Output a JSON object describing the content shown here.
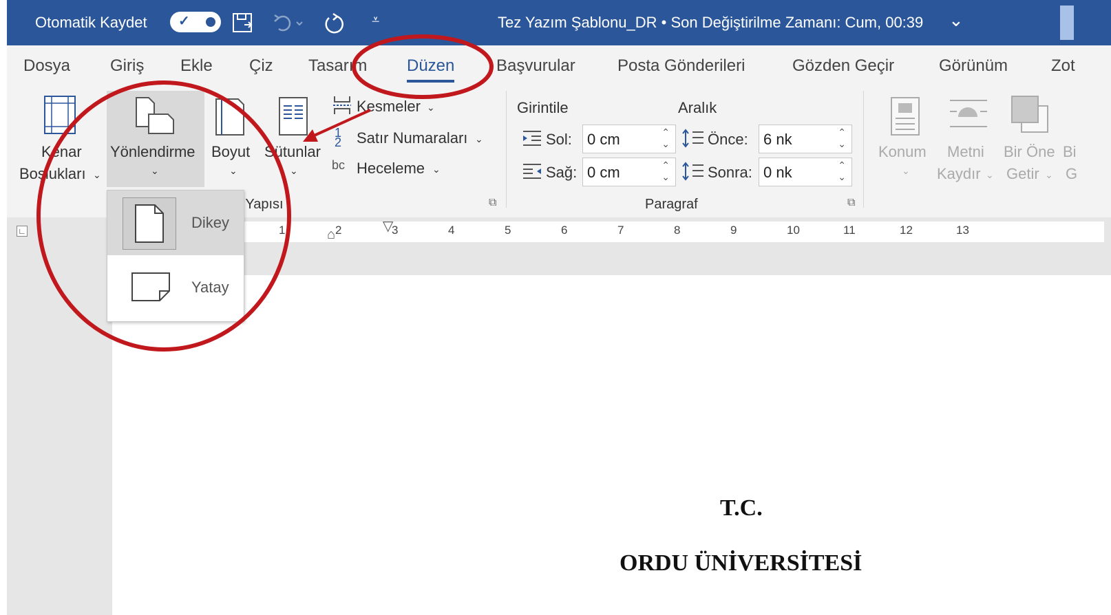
{
  "titlebar": {
    "autosave_label": "Otomatik Kaydet",
    "doc_title": "Tez Yazım Şablonu_DR  •  Son Değiştirilme Zamanı: Cum, 00:39",
    "chevron": "⌄"
  },
  "tabs": [
    "Dosya",
    "Giriş",
    "Ekle",
    "Çiz",
    "Tasarım",
    "Düzen",
    "Başvurular",
    "Posta Gönderileri",
    "Gözden Geçir",
    "Görünüm",
    "Zot"
  ],
  "ribbon": {
    "margins": [
      "Kenar",
      "Boşlukları"
    ],
    "orientation": "Yönlendirme",
    "size": "Boyut",
    "columns": "Sütunlar",
    "breaks": "Kesmeler",
    "line_numbers": "Satır Numaraları",
    "hyphenation": "Heceleme",
    "page_setup_group": "Sayfa Yapısı",
    "indent_title": "Girintile",
    "spacing_title": "Aralık",
    "left_label": "Sol:",
    "left_value": "0 cm",
    "right_label": "Sağ:",
    "right_value": "0 cm",
    "before_label": "Önce:",
    "before_value": "6 nk",
    "after_label": "Sonra:",
    "after_value": "0 nk",
    "paragraph_group": "Paragraf",
    "position": "Konum",
    "wrap_text": [
      "Metni",
      "Kaydır"
    ],
    "bring_forward": [
      "Bir Öne",
      "Getir"
    ]
  },
  "orientation_menu": {
    "portrait": "Dikey",
    "landscape": "Yatay"
  },
  "ruler_numbers": [
    "1",
    "2",
    "3",
    "4",
    "5",
    "6",
    "7",
    "8",
    "9",
    "10",
    "11",
    "12",
    "13"
  ],
  "document": {
    "line1": "T.C.",
    "line2": "ORDU ÜNİVERSİTESİ"
  },
  "annotation_color": "#c0181d",
  "accent": "#2b579a"
}
